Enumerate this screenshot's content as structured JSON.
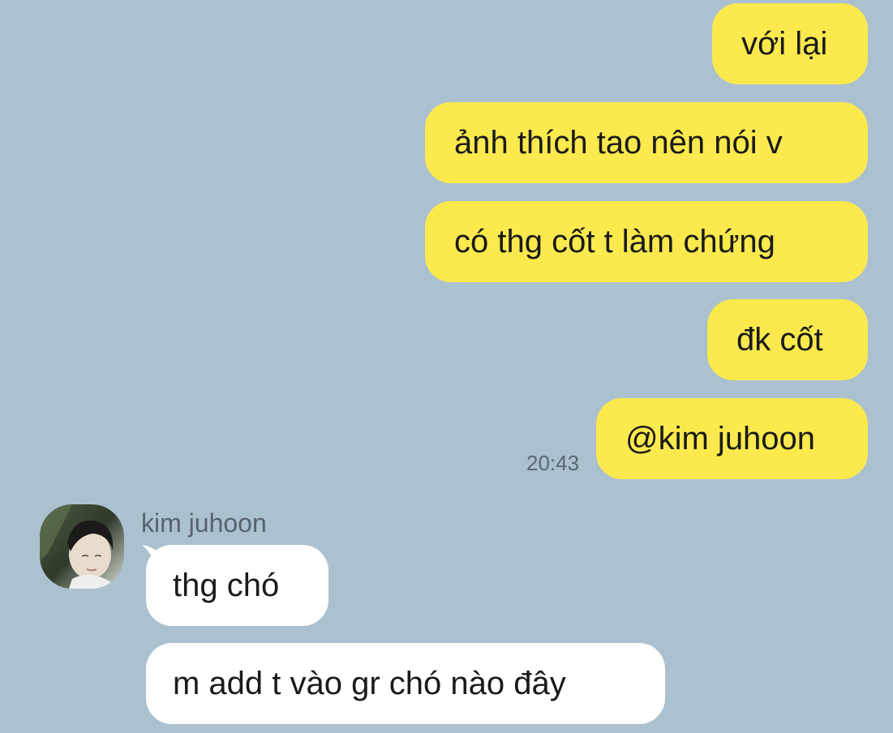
{
  "colors": {
    "background": "#abc1d0",
    "sent_bubble": "#fbe94d",
    "received_bubble": "#ffffff"
  },
  "sent_messages": [
    {
      "text": "với lại"
    },
    {
      "text": "ảnh thích tao nên nói v"
    },
    {
      "text": "có thg cốt t làm chứng"
    },
    {
      "text": "đk cốt"
    },
    {
      "text": "@kim juhoon"
    }
  ],
  "sent_timestamp": "20:43",
  "received": {
    "sender_name": "kim juhoon",
    "avatar_icon": "profile-photo-avatar",
    "messages": [
      {
        "text": "thg chó"
      },
      {
        "text": "m add t vào gr chó nào đây"
      }
    ]
  }
}
